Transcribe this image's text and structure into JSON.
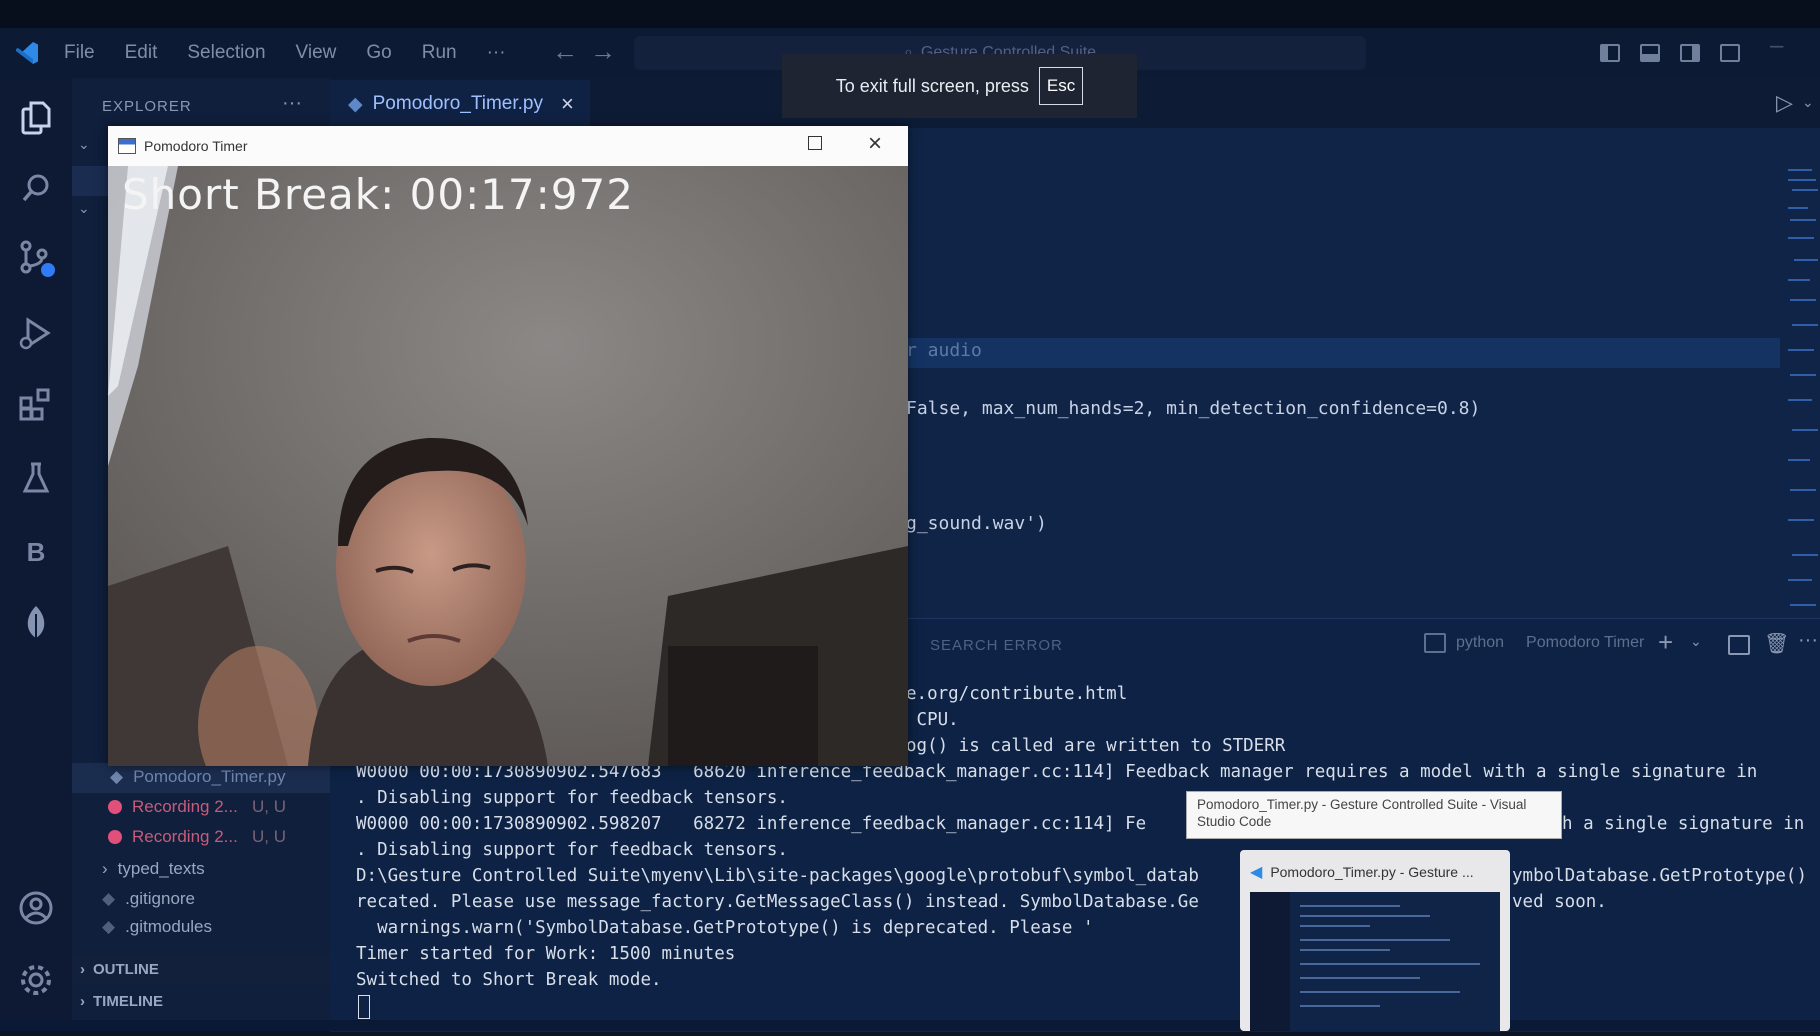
{
  "menu": [
    "File",
    "Edit",
    "Selection",
    "View",
    "Go",
    "Run",
    "···"
  ],
  "command_center": "Gesture Controlled Suite",
  "fullscreen_toast": {
    "text": "To exit full screen, press",
    "key": "Esc"
  },
  "sidebar": {
    "title": "EXPLORER",
    "more": "···",
    "files": [
      {
        "name": "Pomodoro_Timer.py",
        "status": ""
      },
      {
        "name": "Recording 2...",
        "status": "U, U"
      },
      {
        "name": "Recording 2...",
        "status": "U, U"
      },
      {
        "name": "typed_texts",
        "status": ""
      },
      {
        "name": ".gitignore",
        "status": ""
      },
      {
        "name": ".gitmodules",
        "status": ""
      }
    ],
    "outline": "OUTLINE",
    "timeline": "TIMELINE"
  },
  "editor": {
    "tab_label": "Pomodoro_Timer.py",
    "code_lines": [
      "r audio",
      "False, max_num_hands=2, min_detection_confidence=0.8)",
      "g_sound.wav')"
    ]
  },
  "panel": {
    "tab_label": "SEARCH ERROR",
    "shell_label": "python",
    "terminal_name": "Pomodoro Timer",
    "lines": [
      "e.org/contribute.html",
      " CPU.",
      "og() is called are written to STDERR",
      "W0000 00:00:1730890902.547683   68620 inference_feedback_manager.cc:114] Feedback manager requires a model with a single signature in",
      ". Disabling support for feedback tensors.",
      "W0000 00:00:1730890902.598207   68272 inference_feedback_manager.cc:114] Fe",
      ". Disabling support for feedback tensors.",
      "D:\\Gesture Controlled Suite\\myenv\\Lib\\site-packages\\google\\protobuf\\symbol_datab",
      "recated. Please use message_factory.GetMessageClass() instead. SymbolDatabase.Ge",
      "  warnings.warn('SymbolDatabase.GetPrototype() is deprecated. Please '",
      "Timer started for Work: 1500 minutes",
      "Switched to Short Break mode."
    ],
    "right_fragments": [
      "h a single signature in",
      "ymbolDatabase.GetPrototype()",
      "ved soon."
    ]
  },
  "camera_window": {
    "title": "Pomodoro Timer",
    "timer_text": "Short Break: 00:17:972"
  },
  "taskbar_tooltip": "Pomodoro_Timer.py - Gesture Controlled Suite - Visual Studio Code",
  "taskbar_preview_title": "Pomodoro_Timer.py - Gesture ...",
  "colors": {
    "accent": "#4f8cff",
    "background": "#0f2446",
    "badge": "#2f7cf6"
  }
}
